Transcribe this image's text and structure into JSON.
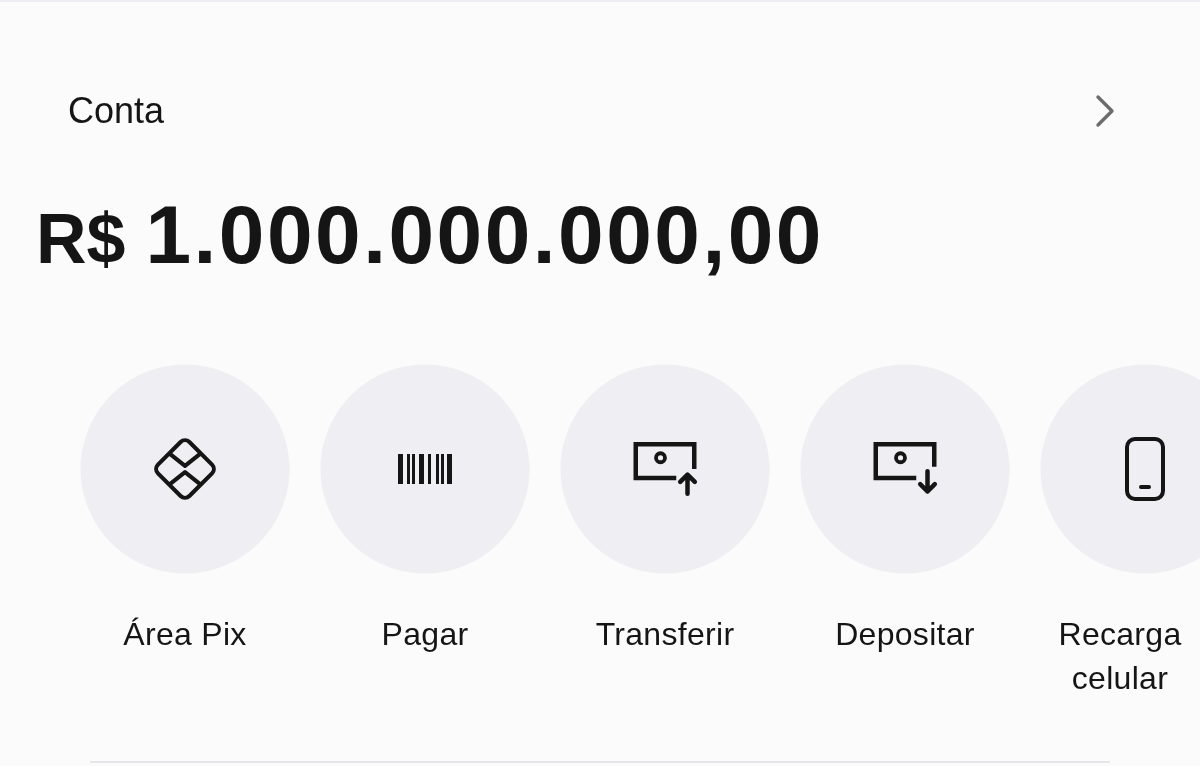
{
  "header": {
    "title": "Conta"
  },
  "balance": {
    "currency": "R$",
    "amount": "1.000.000.000,00"
  },
  "shortcuts": [
    {
      "kind": "pix",
      "label": "Área Pix"
    },
    {
      "kind": "pay",
      "label": "Pagar"
    },
    {
      "kind": "transfer",
      "label": "Transferir"
    },
    {
      "kind": "deposit",
      "label": "Depositar"
    },
    {
      "kind": "recharge",
      "label": "Recarga celular"
    }
  ]
}
